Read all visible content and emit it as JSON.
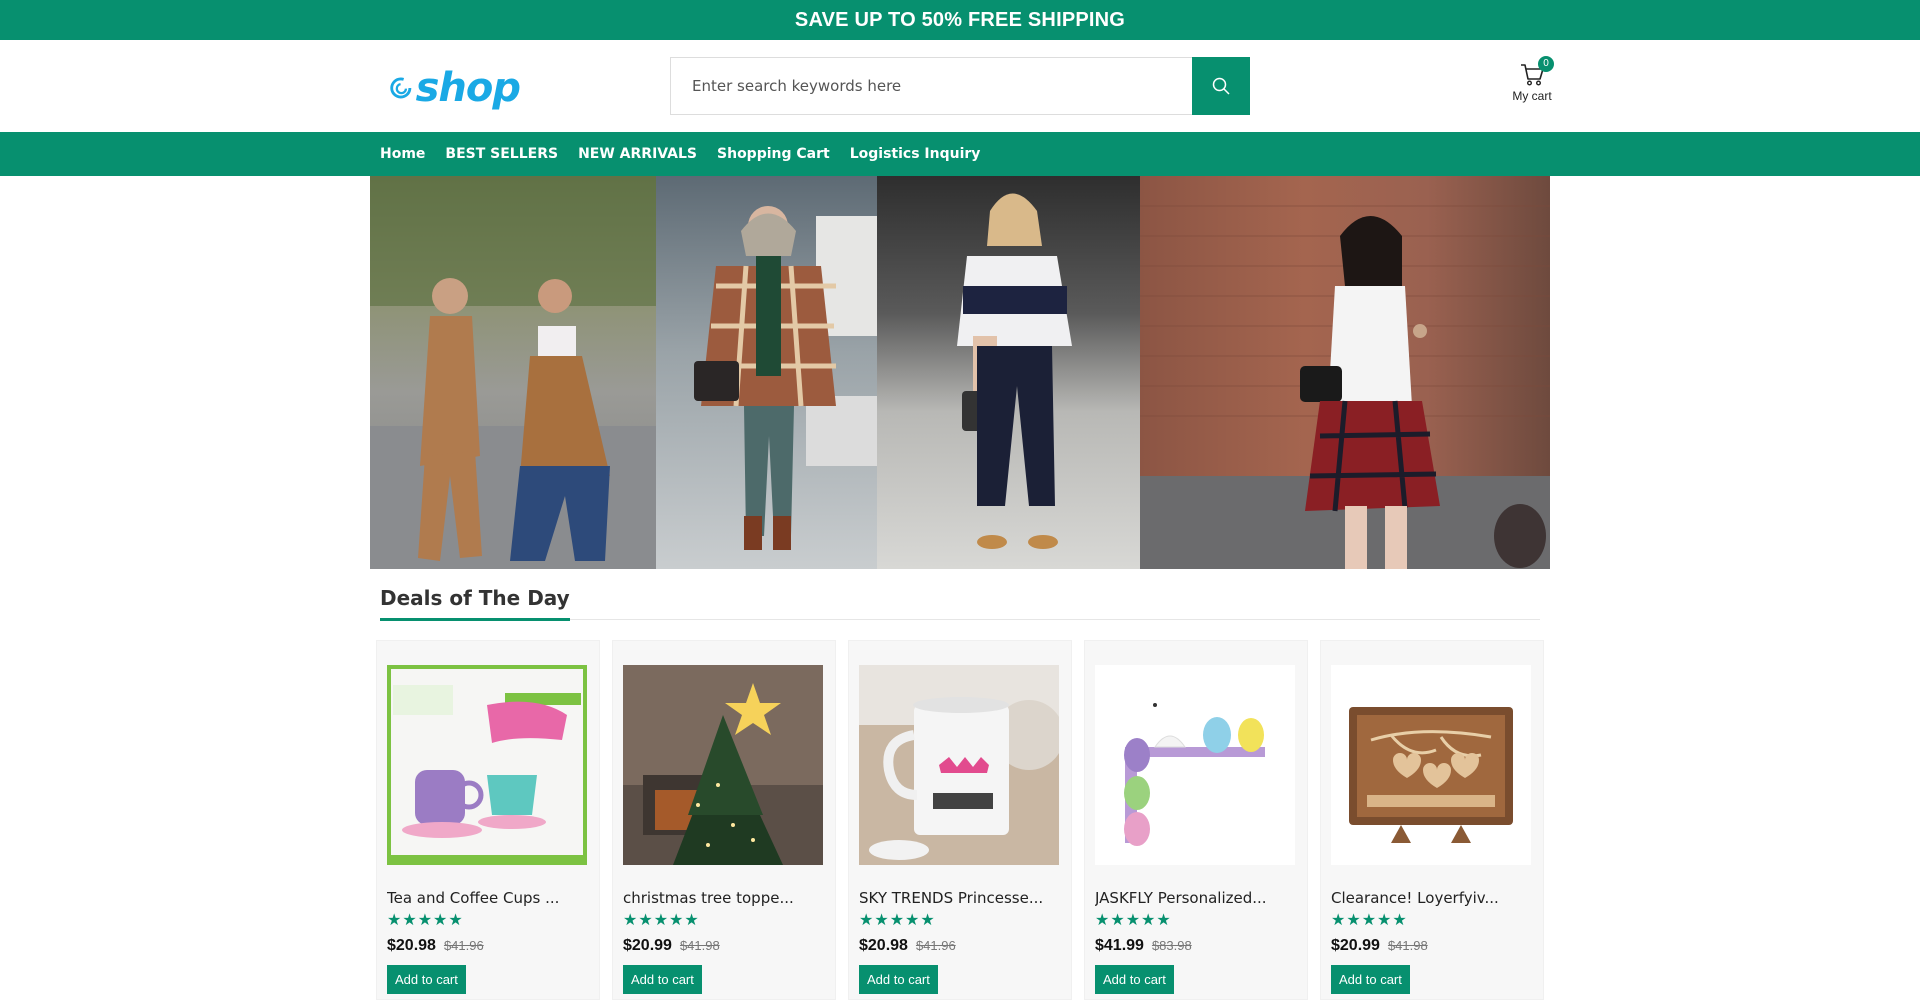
{
  "promo": {
    "text": "SAVE UP TO 50% FREE SHIPPING"
  },
  "header": {
    "logo_text": "shop",
    "search": {
      "placeholder": "Enter search keywords here",
      "value": ""
    },
    "cart": {
      "count": "0",
      "label": "My cart"
    }
  },
  "nav": {
    "items": [
      {
        "label": "Home"
      },
      {
        "label": "BEST SELLERS"
      },
      {
        "label": "NEW ARRIVALS"
      },
      {
        "label": "Shopping Cart"
      },
      {
        "label": "Logistics Inquiry"
      }
    ]
  },
  "deals": {
    "title": "Deals of The Day",
    "products": [
      {
        "name": "Tea and Coffee Cups ...",
        "price": "$20.98",
        "old_price": "$41.96",
        "rating": 5,
        "button": "Add to cart"
      },
      {
        "name": "christmas tree toppe...",
        "price": "$20.99",
        "old_price": "$41.98",
        "rating": 5,
        "button": "Add to cart"
      },
      {
        "name": "SKY TRENDS Princesse...",
        "price": "$20.98",
        "old_price": "$41.96",
        "rating": 5,
        "button": "Add to cart"
      },
      {
        "name": "JASKFLY Personalized...",
        "price": "$41.99",
        "old_price": "$83.98",
        "rating": 5,
        "button": "Add to cart"
      },
      {
        "name": "Clearance! Loyerfyiv...",
        "price": "$20.99",
        "old_price": "$41.98",
        "rating": 5,
        "button": "Add to cart"
      }
    ]
  },
  "colors": {
    "brand": "#07906f",
    "logo": "#1aa9e5"
  }
}
